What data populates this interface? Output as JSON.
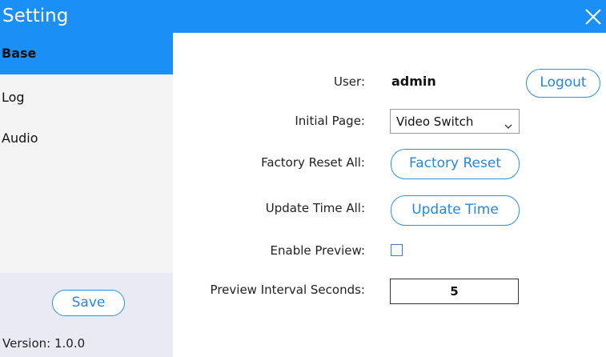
{
  "window": {
    "title": "Setting",
    "close_icon": "close-icon"
  },
  "sidebar": {
    "items": [
      {
        "label": "Base",
        "active": true
      },
      {
        "label": "Log",
        "active": false
      },
      {
        "label": "Audio",
        "active": false
      }
    ],
    "save_label": "Save",
    "version_text": "Version: 1.0.0"
  },
  "form": {
    "user_label": "User:",
    "user_value": "admin",
    "logout_label": "Logout",
    "initial_page_label": "Initial Page:",
    "initial_page_value": "Video Switch",
    "factory_reset_label": "Factory Reset All:",
    "factory_reset_button": "Factory Reset",
    "update_time_label": "Update Time All:",
    "update_time_button": "Update Time",
    "enable_preview_label": "Enable Preview:",
    "enable_preview_checked": false,
    "preview_interval_label": "Preview Interval Seconds:",
    "preview_interval_value": "5"
  },
  "colors": {
    "accent": "#1a8ff5",
    "button_text": "#2a86d9"
  }
}
